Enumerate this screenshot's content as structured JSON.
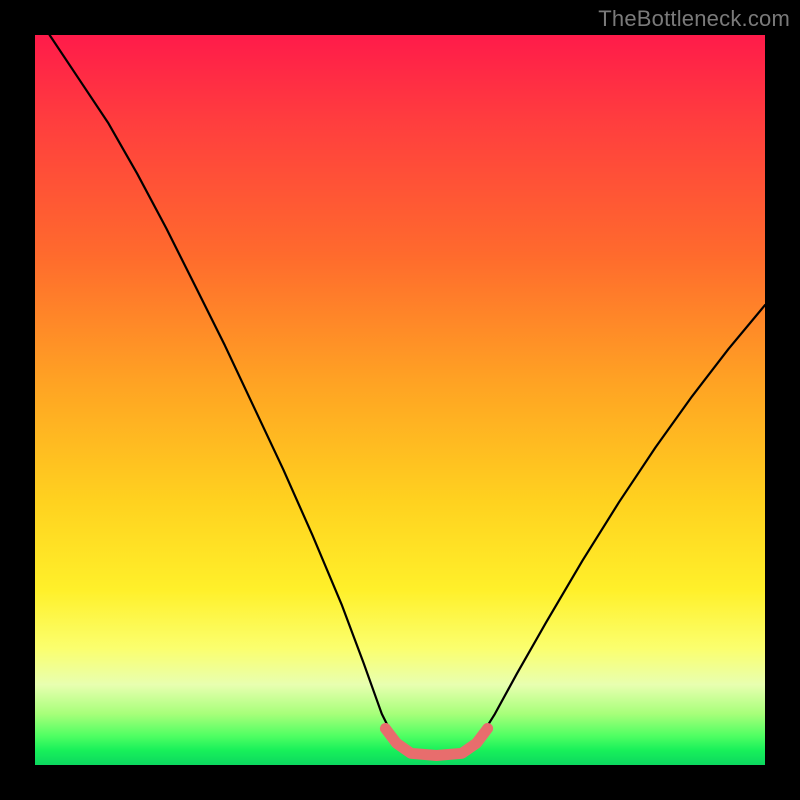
{
  "watermark": "TheBottleneck.com",
  "chart_data": {
    "type": "line",
    "title": "",
    "xlabel": "",
    "ylabel": "",
    "xlim": [
      0,
      100
    ],
    "ylim": [
      0,
      100
    ],
    "grid": false,
    "legend": false,
    "notes": "Axis labels and units are not shown in the image; values are fractional positions of the plot area (0–100). The curve is a V-shaped dip. The pink segment highlights the flat bottom of the dip.",
    "series": [
      {
        "name": "curve-black",
        "color": "#000000",
        "points": [
          {
            "x": 2.0,
            "y": 100.0
          },
          {
            "x": 6.0,
            "y": 94.0
          },
          {
            "x": 10.0,
            "y": 88.0
          },
          {
            "x": 14.0,
            "y": 81.0
          },
          {
            "x": 18.0,
            "y": 73.5
          },
          {
            "x": 22.0,
            "y": 65.5
          },
          {
            "x": 26.0,
            "y": 57.5
          },
          {
            "x": 30.0,
            "y": 49.0
          },
          {
            "x": 34.0,
            "y": 40.5
          },
          {
            "x": 38.0,
            "y": 31.5
          },
          {
            "x": 42.0,
            "y": 22.0
          },
          {
            "x": 45.0,
            "y": 14.0
          },
          {
            "x": 47.5,
            "y": 7.0
          },
          {
            "x": 49.5,
            "y": 3.0
          },
          {
            "x": 51.5,
            "y": 1.4
          },
          {
            "x": 55.0,
            "y": 1.2
          },
          {
            "x": 58.5,
            "y": 1.4
          },
          {
            "x": 60.5,
            "y": 3.0
          },
          {
            "x": 63.0,
            "y": 7.0
          },
          {
            "x": 66.0,
            "y": 12.5
          },
          {
            "x": 70.0,
            "y": 19.5
          },
          {
            "x": 75.0,
            "y": 28.0
          },
          {
            "x": 80.0,
            "y": 36.0
          },
          {
            "x": 85.0,
            "y": 43.5
          },
          {
            "x": 90.0,
            "y": 50.5
          },
          {
            "x": 95.0,
            "y": 57.0
          },
          {
            "x": 100.0,
            "y": 63.0
          }
        ]
      },
      {
        "name": "highlight-pink",
        "color": "#e86d6d",
        "points": [
          {
            "x": 48.0,
            "y": 5.0
          },
          {
            "x": 49.5,
            "y": 3.0
          },
          {
            "x": 51.5,
            "y": 1.6
          },
          {
            "x": 55.0,
            "y": 1.3
          },
          {
            "x": 58.5,
            "y": 1.6
          },
          {
            "x": 60.5,
            "y": 3.0
          },
          {
            "x": 62.0,
            "y": 5.0
          }
        ]
      }
    ]
  }
}
